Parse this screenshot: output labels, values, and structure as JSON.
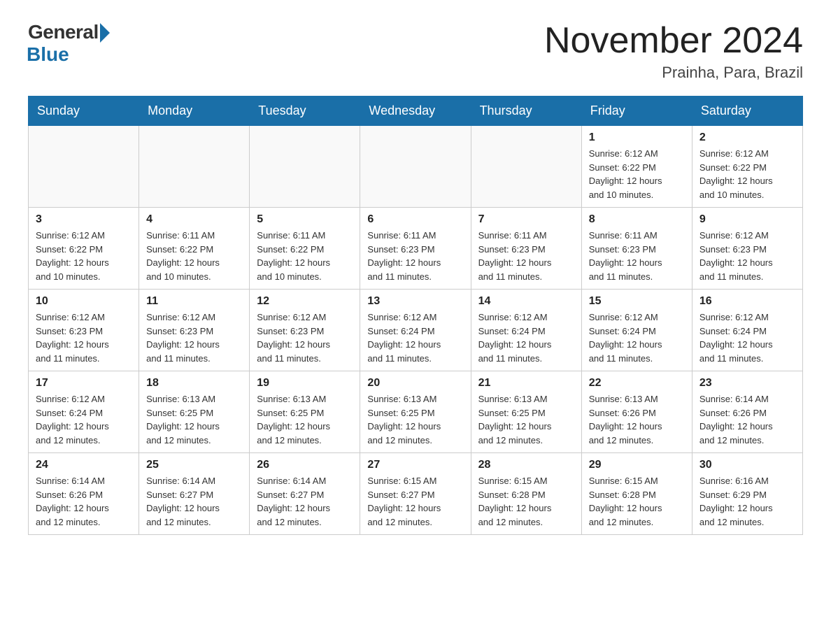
{
  "header": {
    "logo_general": "General",
    "logo_blue": "Blue",
    "title": "November 2024",
    "location": "Prainha, Para, Brazil"
  },
  "days_of_week": [
    "Sunday",
    "Monday",
    "Tuesday",
    "Wednesday",
    "Thursday",
    "Friday",
    "Saturday"
  ],
  "weeks": [
    [
      {
        "day": "",
        "info": ""
      },
      {
        "day": "",
        "info": ""
      },
      {
        "day": "",
        "info": ""
      },
      {
        "day": "",
        "info": ""
      },
      {
        "day": "",
        "info": ""
      },
      {
        "day": "1",
        "info": "Sunrise: 6:12 AM\nSunset: 6:22 PM\nDaylight: 12 hours\nand 10 minutes."
      },
      {
        "day": "2",
        "info": "Sunrise: 6:12 AM\nSunset: 6:22 PM\nDaylight: 12 hours\nand 10 minutes."
      }
    ],
    [
      {
        "day": "3",
        "info": "Sunrise: 6:12 AM\nSunset: 6:22 PM\nDaylight: 12 hours\nand 10 minutes."
      },
      {
        "day": "4",
        "info": "Sunrise: 6:11 AM\nSunset: 6:22 PM\nDaylight: 12 hours\nand 10 minutes."
      },
      {
        "day": "5",
        "info": "Sunrise: 6:11 AM\nSunset: 6:22 PM\nDaylight: 12 hours\nand 10 minutes."
      },
      {
        "day": "6",
        "info": "Sunrise: 6:11 AM\nSunset: 6:23 PM\nDaylight: 12 hours\nand 11 minutes."
      },
      {
        "day": "7",
        "info": "Sunrise: 6:11 AM\nSunset: 6:23 PM\nDaylight: 12 hours\nand 11 minutes."
      },
      {
        "day": "8",
        "info": "Sunrise: 6:11 AM\nSunset: 6:23 PM\nDaylight: 12 hours\nand 11 minutes."
      },
      {
        "day": "9",
        "info": "Sunrise: 6:12 AM\nSunset: 6:23 PM\nDaylight: 12 hours\nand 11 minutes."
      }
    ],
    [
      {
        "day": "10",
        "info": "Sunrise: 6:12 AM\nSunset: 6:23 PM\nDaylight: 12 hours\nand 11 minutes."
      },
      {
        "day": "11",
        "info": "Sunrise: 6:12 AM\nSunset: 6:23 PM\nDaylight: 12 hours\nand 11 minutes."
      },
      {
        "day": "12",
        "info": "Sunrise: 6:12 AM\nSunset: 6:23 PM\nDaylight: 12 hours\nand 11 minutes."
      },
      {
        "day": "13",
        "info": "Sunrise: 6:12 AM\nSunset: 6:24 PM\nDaylight: 12 hours\nand 11 minutes."
      },
      {
        "day": "14",
        "info": "Sunrise: 6:12 AM\nSunset: 6:24 PM\nDaylight: 12 hours\nand 11 minutes."
      },
      {
        "day": "15",
        "info": "Sunrise: 6:12 AM\nSunset: 6:24 PM\nDaylight: 12 hours\nand 11 minutes."
      },
      {
        "day": "16",
        "info": "Sunrise: 6:12 AM\nSunset: 6:24 PM\nDaylight: 12 hours\nand 11 minutes."
      }
    ],
    [
      {
        "day": "17",
        "info": "Sunrise: 6:12 AM\nSunset: 6:24 PM\nDaylight: 12 hours\nand 12 minutes."
      },
      {
        "day": "18",
        "info": "Sunrise: 6:13 AM\nSunset: 6:25 PM\nDaylight: 12 hours\nand 12 minutes."
      },
      {
        "day": "19",
        "info": "Sunrise: 6:13 AM\nSunset: 6:25 PM\nDaylight: 12 hours\nand 12 minutes."
      },
      {
        "day": "20",
        "info": "Sunrise: 6:13 AM\nSunset: 6:25 PM\nDaylight: 12 hours\nand 12 minutes."
      },
      {
        "day": "21",
        "info": "Sunrise: 6:13 AM\nSunset: 6:25 PM\nDaylight: 12 hours\nand 12 minutes."
      },
      {
        "day": "22",
        "info": "Sunrise: 6:13 AM\nSunset: 6:26 PM\nDaylight: 12 hours\nand 12 minutes."
      },
      {
        "day": "23",
        "info": "Sunrise: 6:14 AM\nSunset: 6:26 PM\nDaylight: 12 hours\nand 12 minutes."
      }
    ],
    [
      {
        "day": "24",
        "info": "Sunrise: 6:14 AM\nSunset: 6:26 PM\nDaylight: 12 hours\nand 12 minutes."
      },
      {
        "day": "25",
        "info": "Sunrise: 6:14 AM\nSunset: 6:27 PM\nDaylight: 12 hours\nand 12 minutes."
      },
      {
        "day": "26",
        "info": "Sunrise: 6:14 AM\nSunset: 6:27 PM\nDaylight: 12 hours\nand 12 minutes."
      },
      {
        "day": "27",
        "info": "Sunrise: 6:15 AM\nSunset: 6:27 PM\nDaylight: 12 hours\nand 12 minutes."
      },
      {
        "day": "28",
        "info": "Sunrise: 6:15 AM\nSunset: 6:28 PM\nDaylight: 12 hours\nand 12 minutes."
      },
      {
        "day": "29",
        "info": "Sunrise: 6:15 AM\nSunset: 6:28 PM\nDaylight: 12 hours\nand 12 minutes."
      },
      {
        "day": "30",
        "info": "Sunrise: 6:16 AM\nSunset: 6:29 PM\nDaylight: 12 hours\nand 12 minutes."
      }
    ]
  ]
}
